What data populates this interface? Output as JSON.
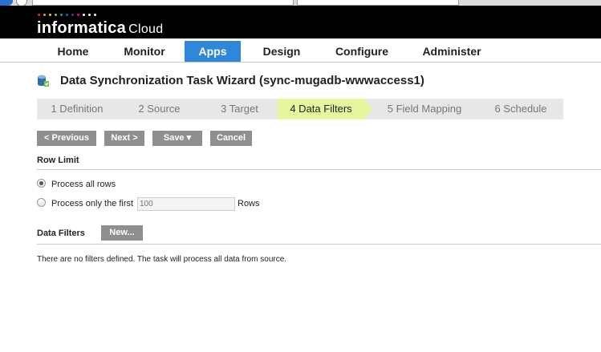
{
  "app": {
    "logo_text": "informatica",
    "logo_suffix": "Cloud",
    "logo_dot_colors": [
      "#e8262b",
      "#f7941d",
      "#ffcc00",
      "#8dc63f",
      "#00a99d",
      "#0072bc",
      "#662d91",
      "#ec008c",
      "#ffffff",
      "#ffffff",
      "#ffffff"
    ]
  },
  "nav": {
    "tabs": [
      {
        "label": "Home"
      },
      {
        "label": "Monitor"
      },
      {
        "label": "Apps",
        "active": true
      },
      {
        "label": "Design"
      },
      {
        "label": "Configure"
      },
      {
        "label": "Administer"
      }
    ]
  },
  "page": {
    "title": "Data Synchronization Task Wizard (sync-mugadb-wwwaccess1)"
  },
  "wizard": {
    "steps": [
      {
        "label": "1 Definition"
      },
      {
        "label": "2 Source"
      },
      {
        "label": "3 Target"
      },
      {
        "label": "4 Data Filters",
        "active": true
      },
      {
        "label": "5 Field Mapping"
      },
      {
        "label": "6 Schedule"
      }
    ]
  },
  "toolbar": {
    "previous_label": "< Previous",
    "next_label": "Next >",
    "save_label": "Save ▾",
    "cancel_label": "Cancel"
  },
  "row_limit": {
    "heading": "Row Limit",
    "option_all": "Process all rows",
    "option_first": "Process only the first",
    "selected": "all",
    "rows_placeholder": "100",
    "rows_suffix": "Rows"
  },
  "data_filters": {
    "heading": "Data Filters",
    "new_button": "New...",
    "empty_message": "There are no filters defined. The task will process all data from source."
  },
  "colors": {
    "nav_active": "#2e87d8",
    "step_active": "#e4f79e",
    "button_bg": "#8f8f8f"
  }
}
